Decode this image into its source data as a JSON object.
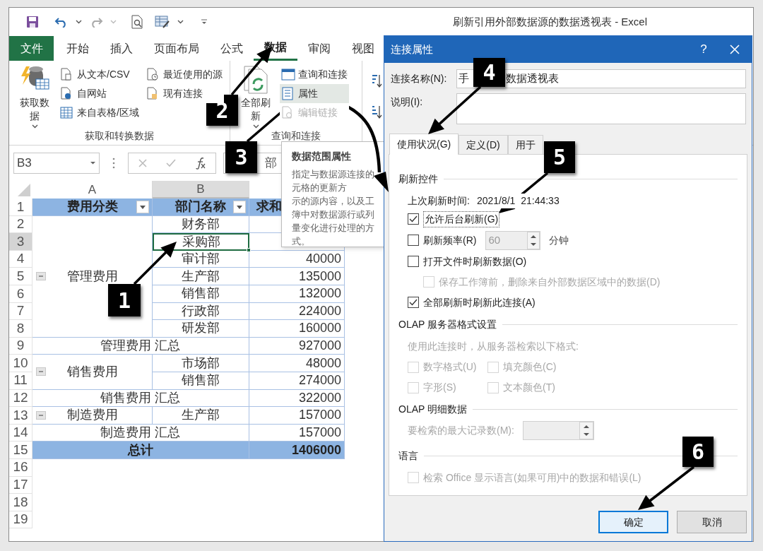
{
  "window": {
    "title": "刷新引用外部数据源的数据透视表 - Excel"
  },
  "ribbon_tabs": [
    {
      "label": "文件",
      "kind": "file",
      "selected": false
    },
    {
      "label": "开始",
      "kind": "tab",
      "selected": false
    },
    {
      "label": "插入",
      "kind": "tab",
      "selected": false
    },
    {
      "label": "页面布局",
      "kind": "tab",
      "selected": false
    },
    {
      "label": "公式",
      "kind": "tab",
      "selected": false
    },
    {
      "label": "数据",
      "kind": "tab",
      "selected": true
    },
    {
      "label": "审阅",
      "kind": "tab",
      "selected": false
    },
    {
      "label": "视图",
      "kind": "tab",
      "selected": false
    }
  ],
  "ribbon_groups": [
    {
      "label": "获取和转换数据",
      "main_button": "获取数据",
      "columns": [
        [
          {
            "label": "从文本/CSV",
            "disabled": false,
            "highlighted": false
          },
          {
            "label": "自网站",
            "disabled": false,
            "highlighted": false
          },
          {
            "label": "来自表格/区域",
            "disabled": false,
            "highlighted": false
          }
        ],
        [
          {
            "label": "最近使用的源",
            "disabled": false,
            "highlighted": false
          },
          {
            "label": "现有连接",
            "disabled": false,
            "highlighted": false
          }
        ]
      ]
    },
    {
      "label": "查询和连接",
      "main_button": "全部刷新",
      "columns": [
        [
          {
            "label": "查询和连接",
            "disabled": false,
            "highlighted": false
          },
          {
            "label": "属性",
            "disabled": false,
            "highlighted": true
          },
          {
            "label": "编辑链接",
            "disabled": true,
            "highlighted": false
          }
        ]
      ]
    }
  ],
  "formula_bar": {
    "name_box": "B3",
    "value": "部"
  },
  "sheet": {
    "column_headers": [
      {
        "label": "A",
        "selected": false
      },
      {
        "label": "B",
        "selected": true
      }
    ],
    "row_headers": [
      {
        "label": "1",
        "selected": false
      },
      {
        "label": "2",
        "selected": false
      },
      {
        "label": "3",
        "selected": true
      },
      {
        "label": "4",
        "selected": false
      },
      {
        "label": "5",
        "selected": false
      },
      {
        "label": "6",
        "selected": false
      },
      {
        "label": "7",
        "selected": false
      },
      {
        "label": "8",
        "selected": false
      },
      {
        "label": "9",
        "selected": false
      },
      {
        "label": "10",
        "selected": false
      },
      {
        "label": "11",
        "selected": false
      },
      {
        "label": "12",
        "selected": false
      },
      {
        "label": "13",
        "selected": false
      },
      {
        "label": "14",
        "selected": false
      },
      {
        "label": "15",
        "selected": false
      },
      {
        "label": "16",
        "selected": false
      },
      {
        "label": "17",
        "selected": false
      },
      {
        "label": "18",
        "selected": false
      },
      {
        "label": "19",
        "selected": false
      }
    ]
  },
  "pivot": {
    "headers": [
      {
        "label": "费用分类",
        "filter": true
      },
      {
        "label": "部门名称",
        "filter": true
      },
      {
        "label": "求和"
      }
    ],
    "groups": [
      {
        "category": "管理费用",
        "expanded": true,
        "rows": [
          {
            "dept": "财务部",
            "selected": false
          },
          {
            "dept": "采购部",
            "selected": true
          },
          {
            "dept": "审计部",
            "value": "40000",
            "selected": false
          },
          {
            "dept": "生产部",
            "value": "135000",
            "selected": false
          },
          {
            "dept": "销售部",
            "value": "132000",
            "selected": false
          },
          {
            "dept": "行政部",
            "value": "224000",
            "selected": false
          },
          {
            "dept": "研发部",
            "value": "160000",
            "selected": false
          }
        ],
        "subtotal": {
          "label": "管理费用 汇总",
          "value": "927000"
        }
      },
      {
        "category": "销售费用",
        "expanded": true,
        "rows": [
          {
            "dept": "市场部",
            "value": "48000",
            "selected": false
          },
          {
            "dept": "销售部",
            "value": "274000",
            "selected": false
          }
        ],
        "subtotal": {
          "label": "销售费用 汇总",
          "value": "322000"
        }
      },
      {
        "category": "制造费用",
        "expanded": true,
        "rows": [
          {
            "dept": "生产部",
            "value": "157000",
            "selected": false
          }
        ],
        "subtotal": {
          "label": "制造费用 汇总",
          "value": "157000"
        }
      }
    ],
    "grand_total": {
      "label": "总计",
      "value": "1406000"
    }
  },
  "tooltip": {
    "title": "数据范围属性",
    "lines": [
      "指定与数据源连接的",
      "元格的更新方",
      "示的源内容，以及工",
      "簿中对数据源行或列",
      "量变化进行处理的方",
      "式。"
    ]
  },
  "dialog": {
    "title": "连接属性",
    "help": "?",
    "name_field": {
      "label": "连接名称(N):",
      "value_parts": [
        "手",
        "数据透视表"
      ]
    },
    "description_field": {
      "label": "说明(I):"
    },
    "tabs": [
      {
        "label": "使用状况(G)",
        "selected": true
      },
      {
        "label": "定义(D)",
        "selected": false
      },
      {
        "label": "用于",
        "selected": false
      }
    ],
    "refresh_control": {
      "heading": "刷新控件",
      "last_refresh_label": "上次刷新时间:",
      "last_refresh_value": "2021/8/1  21:44:33",
      "options": [
        {
          "kind": "checkbox",
          "label": "允许后台刷新(G)",
          "checked": true,
          "disabled": false,
          "focused": true
        },
        {
          "kind": "spin",
          "label": "刷新频率(R)",
          "checked": false,
          "disabled": false,
          "focused": false,
          "spin_value": "60",
          "spin_disabled": true,
          "unit": "分钟"
        },
        {
          "kind": "checkbox",
          "label": "打开文件时刷新数据(O)",
          "checked": false,
          "disabled": false,
          "focused": false,
          "children": [
            {
              "kind": "checkbox",
              "label": "保存工作簿前，删除来自外部数据区域中的数据(D)",
              "checked": false,
              "disabled": true,
              "focused": false
            }
          ]
        },
        {
          "kind": "checkbox",
          "label": "全部刷新时刷新此连接(A)",
          "checked": true,
          "disabled": false,
          "focused": false
        }
      ]
    },
    "olap_format": {
      "heading": "OLAP 服务器格式设置",
      "note": "使用此连接时，从服务器检索以下格式:",
      "disabled": true,
      "options": [
        {
          "label": "数字格式(U)",
          "checked": false,
          "disabled": true
        },
        {
          "label": "填充颜色(C)",
          "checked": false,
          "disabled": true
        },
        {
          "label": "字形(S)",
          "checked": false,
          "disabled": true
        },
        {
          "label": "文本颜色(T)",
          "checked": false,
          "disabled": true
        }
      ]
    },
    "olap_detail": {
      "heading": "OLAP 明细数据",
      "max_records_label": "要检索的最大记录数(M):",
      "disabled": true
    },
    "language": {
      "heading": "语言",
      "options": [
        {
          "label": "检索 Office 显示语言(如果可用)中的数据和错误(L)",
          "checked": false,
          "disabled": true
        }
      ]
    },
    "buttons": [
      {
        "label": "确定",
        "default": true
      },
      {
        "label": "取消",
        "default": false
      }
    ]
  },
  "callouts": [
    {
      "label": "1"
    },
    {
      "label": "2"
    },
    {
      "label": "3"
    },
    {
      "label": "4"
    },
    {
      "label": "5"
    },
    {
      "label": "6"
    }
  ]
}
